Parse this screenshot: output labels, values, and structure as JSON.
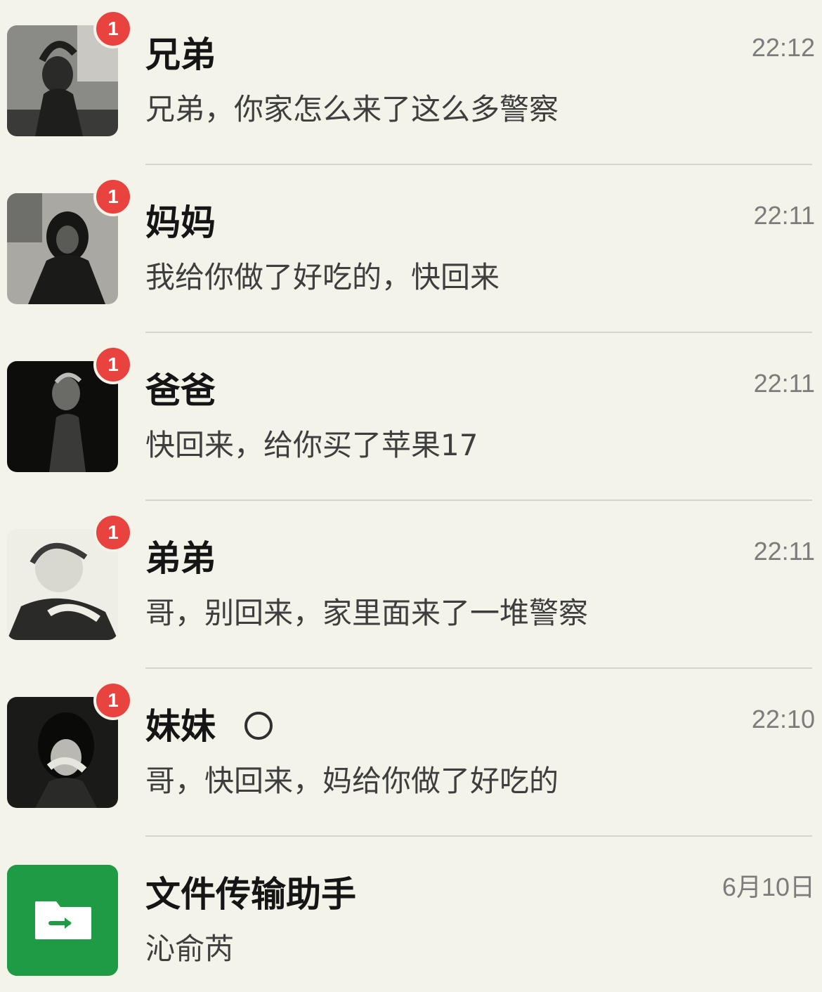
{
  "colors": {
    "background": "#f4f3ea",
    "badge": "#e8433f",
    "file_helper_green": "#1f9b45"
  },
  "chats": [
    {
      "name": "兄弟",
      "preview": "兄弟，你家怎么来了这么多警察",
      "time": "22:12",
      "unread": "1"
    },
    {
      "name": "妈妈",
      "preview": "我给你做了好吃的，快回来",
      "time": "22:11",
      "unread": "1"
    },
    {
      "name": "爸爸",
      "preview": "快回来，给你买了苹果17",
      "time": "22:11",
      "unread": "1"
    },
    {
      "name": "弟弟",
      "preview": "哥，别回来，家里面来了一堆警察",
      "time": "22:11",
      "unread": "1"
    },
    {
      "name": "妹妹",
      "preview": "哥，快回来，妈给你做了好吃的",
      "time": "22:10",
      "unread": "1",
      "status_icon": "status-ring-icon"
    },
    {
      "name": "文件传输助手",
      "preview": "沁俞芮",
      "time": "6月10日",
      "avatar_icon": "file-transfer-icon"
    }
  ]
}
